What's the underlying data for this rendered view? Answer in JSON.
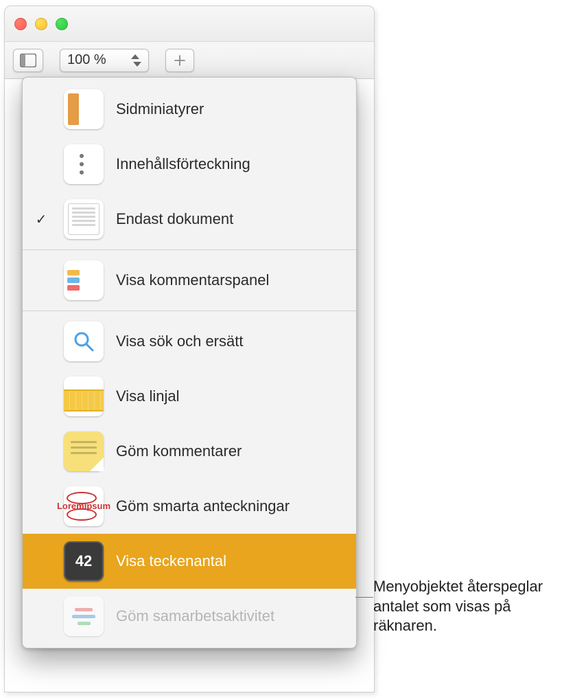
{
  "toolbar": {
    "zoom_value": "100 %"
  },
  "view_menu": {
    "items": [
      {
        "label": "Sidminiatyrer",
        "checked": false
      },
      {
        "label": "Innehållsförteckning",
        "checked": false
      },
      {
        "label": "Endast dokument",
        "checked": true
      },
      {
        "label": "Visa kommentarspanel",
        "checked": false
      },
      {
        "label": "Visa sök och ersätt",
        "checked": false
      },
      {
        "label": "Visa linjal",
        "checked": false
      },
      {
        "label": "Göm kommentarer",
        "checked": false
      },
      {
        "label": "Göm smarta anteckningar",
        "checked": false
      },
      {
        "label": "Visa teckenantal",
        "checked": false,
        "highlighted": true
      },
      {
        "label": "Göm samarbetsaktivitet",
        "checked": false,
        "disabled": true
      }
    ],
    "count_badge": "42",
    "smart_text_line1": "Lorem",
    "smart_text_line2": "Ipsum"
  },
  "callout": {
    "text": "Menyobjektet återspeglar antalet som visas på räknaren."
  }
}
